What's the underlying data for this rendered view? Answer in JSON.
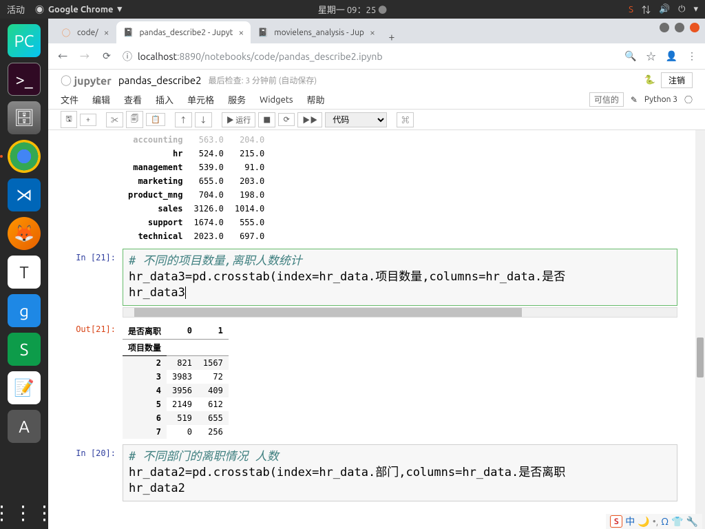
{
  "topbar": {
    "activities": "活动",
    "app_title": "Google Chrome",
    "datetime": "星期一 09：25"
  },
  "tabs": {
    "t1": "code/",
    "t2": "pandas_describe2 - Jupyt",
    "t3": "movielens_analysis - Jup"
  },
  "addr": {
    "info_icon": "ⓘ",
    "host": "localhost",
    "port_path": ":8890/notebooks/code/pandas_describe2.ipynb"
  },
  "jp": {
    "logo": "jupyter",
    "title": "pandas_describe2",
    "checkpoint": "最后检查: 3 分钟前 (自动保存)",
    "logout": "注销",
    "trusted": "可信的",
    "kernel": "Python 3"
  },
  "menu": {
    "file": "文件",
    "edit": "编辑",
    "view": "查看",
    "insert": "插入",
    "cell": "单元格",
    "kernel": "服务",
    "widgets": "Widgets",
    "help": "帮助"
  },
  "toolbar": {
    "run": "运行",
    "celltype": "代码"
  },
  "table1": {
    "rows": [
      {
        "label": "accounting",
        "c0": "563.0",
        "c1": "204.0"
      },
      {
        "label": "hr",
        "c0": "524.0",
        "c1": "215.0"
      },
      {
        "label": "management",
        "c0": "539.0",
        "c1": "91.0"
      },
      {
        "label": "marketing",
        "c0": "655.0",
        "c1": "203.0"
      },
      {
        "label": "product_mng",
        "c0": "704.0",
        "c1": "198.0"
      },
      {
        "label": "sales",
        "c0": "3126.0",
        "c1": "1014.0"
      },
      {
        "label": "support",
        "c0": "1674.0",
        "c1": "555.0"
      },
      {
        "label": "technical",
        "c0": "2023.0",
        "c1": "697.0"
      }
    ]
  },
  "cell21": {
    "prompt_in": "In [21]:",
    "prompt_out": "Out[21]:",
    "comment": "# 不同的项目数量,离职人数统计",
    "line1a": "hr_data3=pd.crosstab(index=hr_data.项目数量,columns=hr_data.是否",
    "line2": "hr_data3"
  },
  "table2": {
    "col_name": "是否离职",
    "index_name": "项目数量",
    "cols": [
      "0",
      "1"
    ],
    "rows": [
      {
        "label": "2",
        "c0": "821",
        "c1": "1567"
      },
      {
        "label": "3",
        "c0": "3983",
        "c1": "72"
      },
      {
        "label": "4",
        "c0": "3956",
        "c1": "409"
      },
      {
        "label": "5",
        "c0": "2149",
        "c1": "612"
      },
      {
        "label": "6",
        "c0": "519",
        "c1": "655"
      },
      {
        "label": "7",
        "c0": "0",
        "c1": "256"
      }
    ]
  },
  "cell20": {
    "prompt_in": "In [20]:",
    "comment": "# 不同部门的离职情况 人数",
    "line1": "hr_data2=pd.crosstab(index=hr_data.部门,columns=hr_data.是否离职",
    "line2": "hr_data2"
  },
  "tray": {
    "zh": "中"
  }
}
